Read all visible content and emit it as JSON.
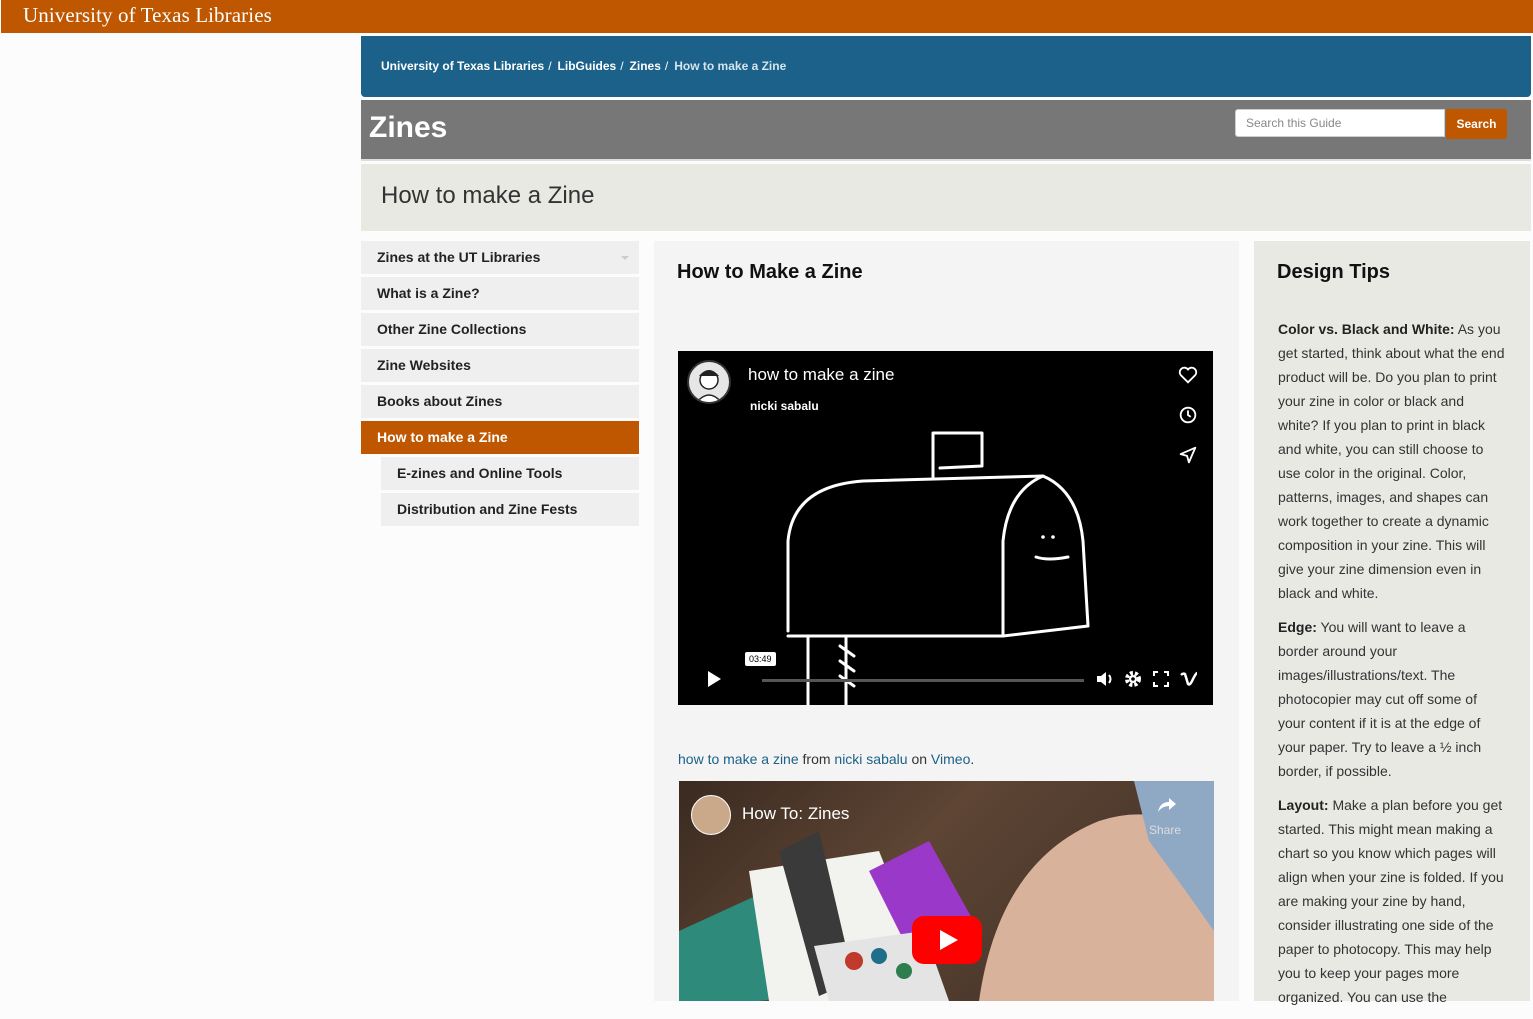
{
  "topbar": {
    "brand": "University of Texas Libraries"
  },
  "breadcrumb": {
    "items": [
      "University of Texas Libraries",
      "LibGuides",
      "Zines",
      "How to make a Zine"
    ]
  },
  "guide": {
    "title": "Zines",
    "search_placeholder": "Search this Guide",
    "search_label": "Search"
  },
  "page": {
    "title": "How to make a Zine"
  },
  "sidenav": {
    "items": [
      "Zines at the UT Libraries",
      "What is a Zine?",
      "Other Zine Collections",
      "Zine Websites",
      "Books about Zines",
      "How to make a Zine",
      "E-zines and Online Tools",
      "Distribution and Zine Fests"
    ]
  },
  "main": {
    "heading": "How to Make a Zine",
    "video1": {
      "title": "how to make a zine",
      "author": "nicki sabalu",
      "timestamp": "03:49"
    },
    "caption": {
      "link1": "how to make a zine",
      "from": " from ",
      "link2": "nicki sabalu",
      "on": " on ",
      "link3": "Vimeo",
      "end": "."
    },
    "video2": {
      "title": "How To: Zines",
      "share": "Share"
    }
  },
  "right": {
    "heading": "Design Tips",
    "tips": [
      {
        "label": "Color vs. Black and White:",
        "text": " As you get started, think about what the end product will be. Do you plan to print your zine in color or black and white? If you plan to print in black and white, you can still choose to use color in the original. Color, patterns, images, and shapes can work together to create a dynamic composition in your zine. This will give your zine dimension even in black and white."
      },
      {
        "label": "Edge:",
        "text": " You will want to leave a border around your images/illustrations/text. The photocopier may cut off some of your content if it is at the edge of your paper. Try to leave a ½ inch border, if possible."
      },
      {
        "label": "Layout:",
        "text": " Make a plan before you get started. This might mean making a chart so you know which pages will align when your zine is folded. If you are making your zine by hand, consider illustrating one side of the paper to photocopy. This may help you to keep your pages more organized. You can use the"
      }
    ]
  },
  "colors": {
    "accent": "#bf5700",
    "blue": "#1b6189",
    "gray": "#777777"
  }
}
